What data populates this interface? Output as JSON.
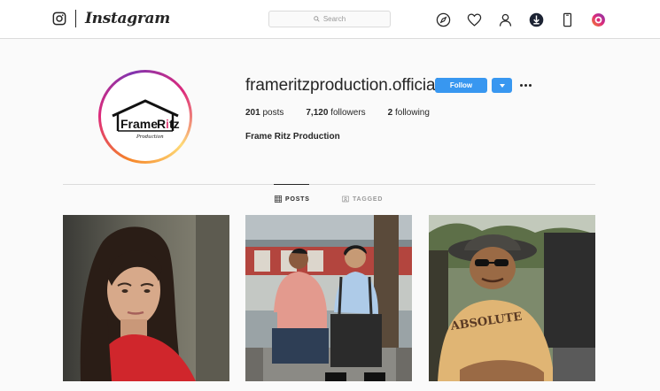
{
  "header": {
    "wordmark": "Instagram",
    "search_placeholder": "Search",
    "icons": [
      "explore-icon",
      "heart-icon",
      "profile-icon",
      "download-icon",
      "mobile-icon",
      "extension-icon"
    ]
  },
  "profile": {
    "username": "frameritzproduction.official",
    "follow_label": "Follow",
    "posts_count": "201",
    "posts_label": "posts",
    "followers_count": "7,120",
    "followers_label": "followers",
    "following_count": "2",
    "following_label": "following",
    "full_name": "Frame Ritz Production",
    "avatar_logo": {
      "main": "Frame Ritz",
      "sub": "Production"
    }
  },
  "tabs": [
    {
      "label": "POSTS",
      "icon": "grid-icon",
      "active": true
    },
    {
      "label": "TAGGED",
      "icon": "tag-icon",
      "active": false
    }
  ],
  "posts": [
    {
      "subject": "woman-portrait"
    },
    {
      "subject": "two-men-street"
    },
    {
      "subject": "man-with-hat"
    }
  ],
  "colors": {
    "accent": "#3897f0",
    "border": "#dbdbdb",
    "text": "#262626",
    "muted": "#999999"
  }
}
